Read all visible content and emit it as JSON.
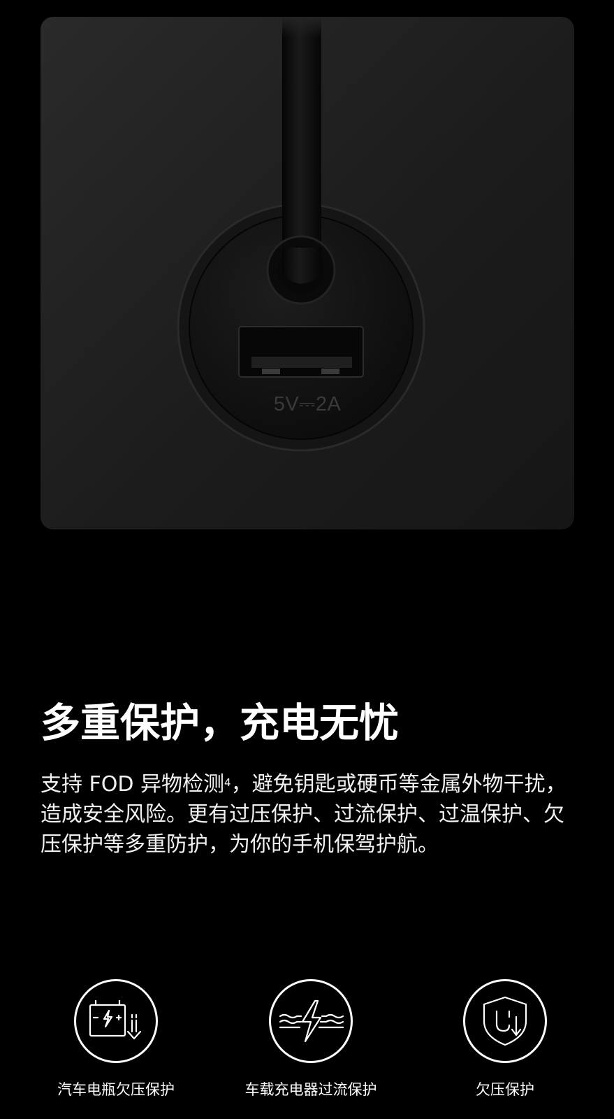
{
  "hero": {
    "port_label": "5V⎓2A"
  },
  "headline": "多重保护，充电无忧",
  "body": {
    "text_before": "支持 FOD 异物检测",
    "footnote": "4",
    "text_after": "，避免钥匙或硬币等金属外物干扰，造成安全风险。更有过压保护、过流保护、过温保护、欠压保护等多重防护，为你的手机保驾护航。"
  },
  "features": [
    {
      "label": "汽车电瓶欠压保护",
      "icon": "battery-undervoltage-icon"
    },
    {
      "label": "车载充电器过流保护",
      "icon": "lightning-overcurrent-icon"
    },
    {
      "label": "欠压保护",
      "icon": "shield-undervoltage-icon"
    }
  ],
  "colors": {
    "background": "#000000",
    "text": "#ffffff",
    "card": "#1e1e1e"
  }
}
